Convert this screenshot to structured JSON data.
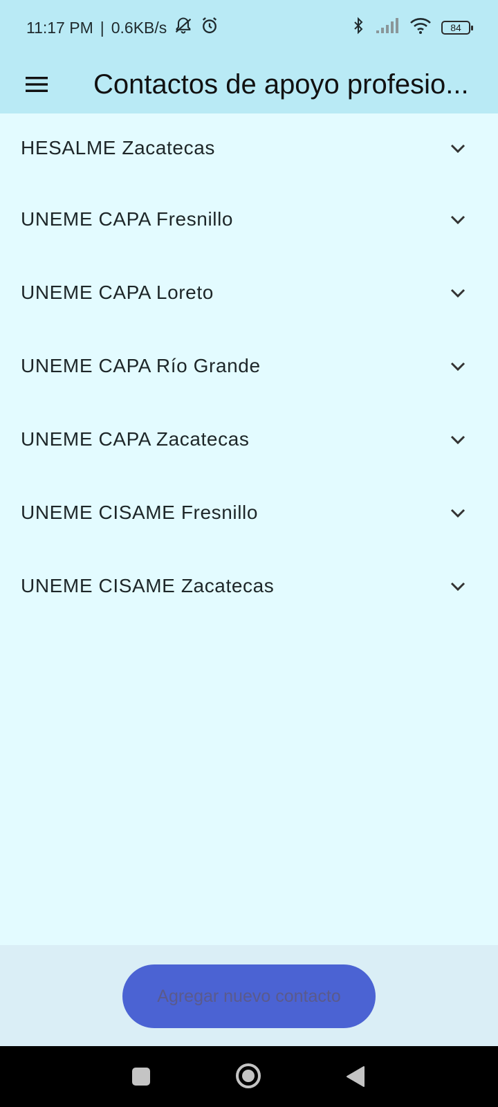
{
  "status_bar": {
    "time": "11:17 PM",
    "separator": "|",
    "network_speed": "0.6KB/s",
    "battery": "84",
    "icons": [
      "silent-bell-icon",
      "alarm-icon",
      "bluetooth-icon",
      "signal-icon",
      "wifi-icon",
      "battery-icon"
    ]
  },
  "app_bar": {
    "title": "Contactos de apoyo profesio...",
    "menu_icon": "menu-icon"
  },
  "contacts": [
    {
      "label": "HESALME Zacatecas"
    },
    {
      "label": "UNEME CAPA Fresnillo"
    },
    {
      "label": "UNEME CAPA Loreto"
    },
    {
      "label": "UNEME CAPA Río Grande"
    },
    {
      "label": "UNEME CAPA Zacatecas"
    },
    {
      "label": "UNEME CISAME Fresnillo"
    },
    {
      "label": "UNEME CISAME Zacatecas"
    }
  ],
  "add_button": {
    "label": "Agregar nuevo contacto"
  },
  "nav_bar": {
    "icons": [
      "recents-icon",
      "home-icon",
      "back-icon"
    ]
  },
  "colors": {
    "app_bar": "#b9eaf5",
    "background": "#e3fbff",
    "bottom_area": "#daeef6",
    "button": "#4b63d3",
    "button_text": "#5a5a8c"
  }
}
